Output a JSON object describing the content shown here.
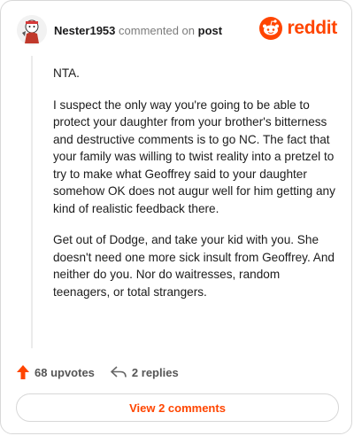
{
  "header": {
    "username": "Nester1953",
    "commented_on": "commented on",
    "post_link": "post",
    "brand": "reddit"
  },
  "comment": {
    "paragraphs": [
      "NTA.",
      "I suspect the only way you're going to be able to protect your daughter from your brother's bitterness and destructive comments is to go NC. The fact that your family was willing to twist reality into a pretzel to try to make what Geoffrey said to your daughter somehow OK does not augur well for him getting any kind of realistic feedback there.",
      "Get out of Dodge, and take your kid with you. She doesn't need one more sick insult from Geoffrey. And neither do you. Nor do waitresses, random teenagers, or total strangers."
    ]
  },
  "actions": {
    "upvotes": "68 upvotes",
    "replies": "2 replies"
  },
  "footer": {
    "view_comments": "View 2 comments"
  },
  "colors": {
    "brand_orange": "#ff4500",
    "upvote_orange": "#ff4500"
  },
  "icons": {
    "avatar": "avatar-icon",
    "logo": "reddit-alien-icon",
    "upvote": "upvote-arrow-icon",
    "reply": "reply-arrow-icon"
  }
}
